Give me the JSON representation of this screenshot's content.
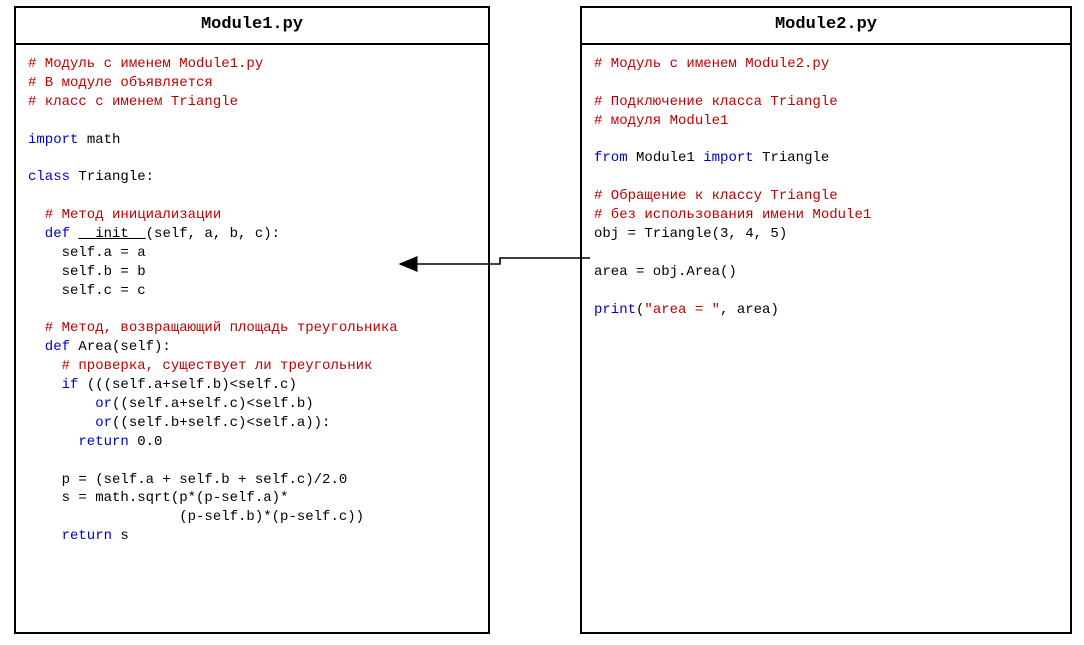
{
  "module1": {
    "title": "Module1.py",
    "l1": "# Модуль с именем Module1.py",
    "l2": "# В модуле объявляется",
    "l3": "# класс с именем Triangle",
    "l4a": "import",
    "l4b": " math",
    "l5a": "class",
    "l5b": " Triangle:",
    "l6": "  # Метод инициализации",
    "l7a": "  def ",
    "l7b": "__init__",
    "l7c": "(self, a, b, c):",
    "l8": "    self.a = a",
    "l9": "    self.b = b",
    "l10": "    self.c = c",
    "l11": "  # Метод, возвращающий площадь треугольника",
    "l12a": "  def ",
    "l12b": "Area(self):",
    "l13": "    # проверка, существует ли треугольник",
    "l14a": "    if",
    "l14b": " (((self.a+self.b)<self.c)",
    "l15a": "        or",
    "l15b": "((self.a+self.c)<self.b)",
    "l16a": "        or",
    "l16b": "((self.b+self.c)<self.a)):",
    "l17a": "      return",
    "l17b": " 0.0",
    "l18": "    p = (self.a + self.b + self.c)/2.0",
    "l19": "    s = math.sqrt(p*(p-self.a)*",
    "l20": "                  (p-self.b)*(p-self.c))",
    "l21a": "    return",
    "l21b": " s"
  },
  "module2": {
    "title": "Module2.py",
    "l1": "# Модуль с именем Module2.py",
    "l2": "# Подключение класса Triangle",
    "l3": "# модуля Module1",
    "l4a": "from",
    "l4b": " Module1 ",
    "l4c": "import",
    "l4d": " Triangle",
    "l5": "# Обращение к классу Triangle",
    "l6": "# без использования имени Module1",
    "l7": "obj = Triangle(3, 4, 5)",
    "l8": "area = obj.Area()",
    "l9a": "print",
    "l9b": "(",
    "l9c": "\"area = \"",
    "l9d": ", area)"
  }
}
